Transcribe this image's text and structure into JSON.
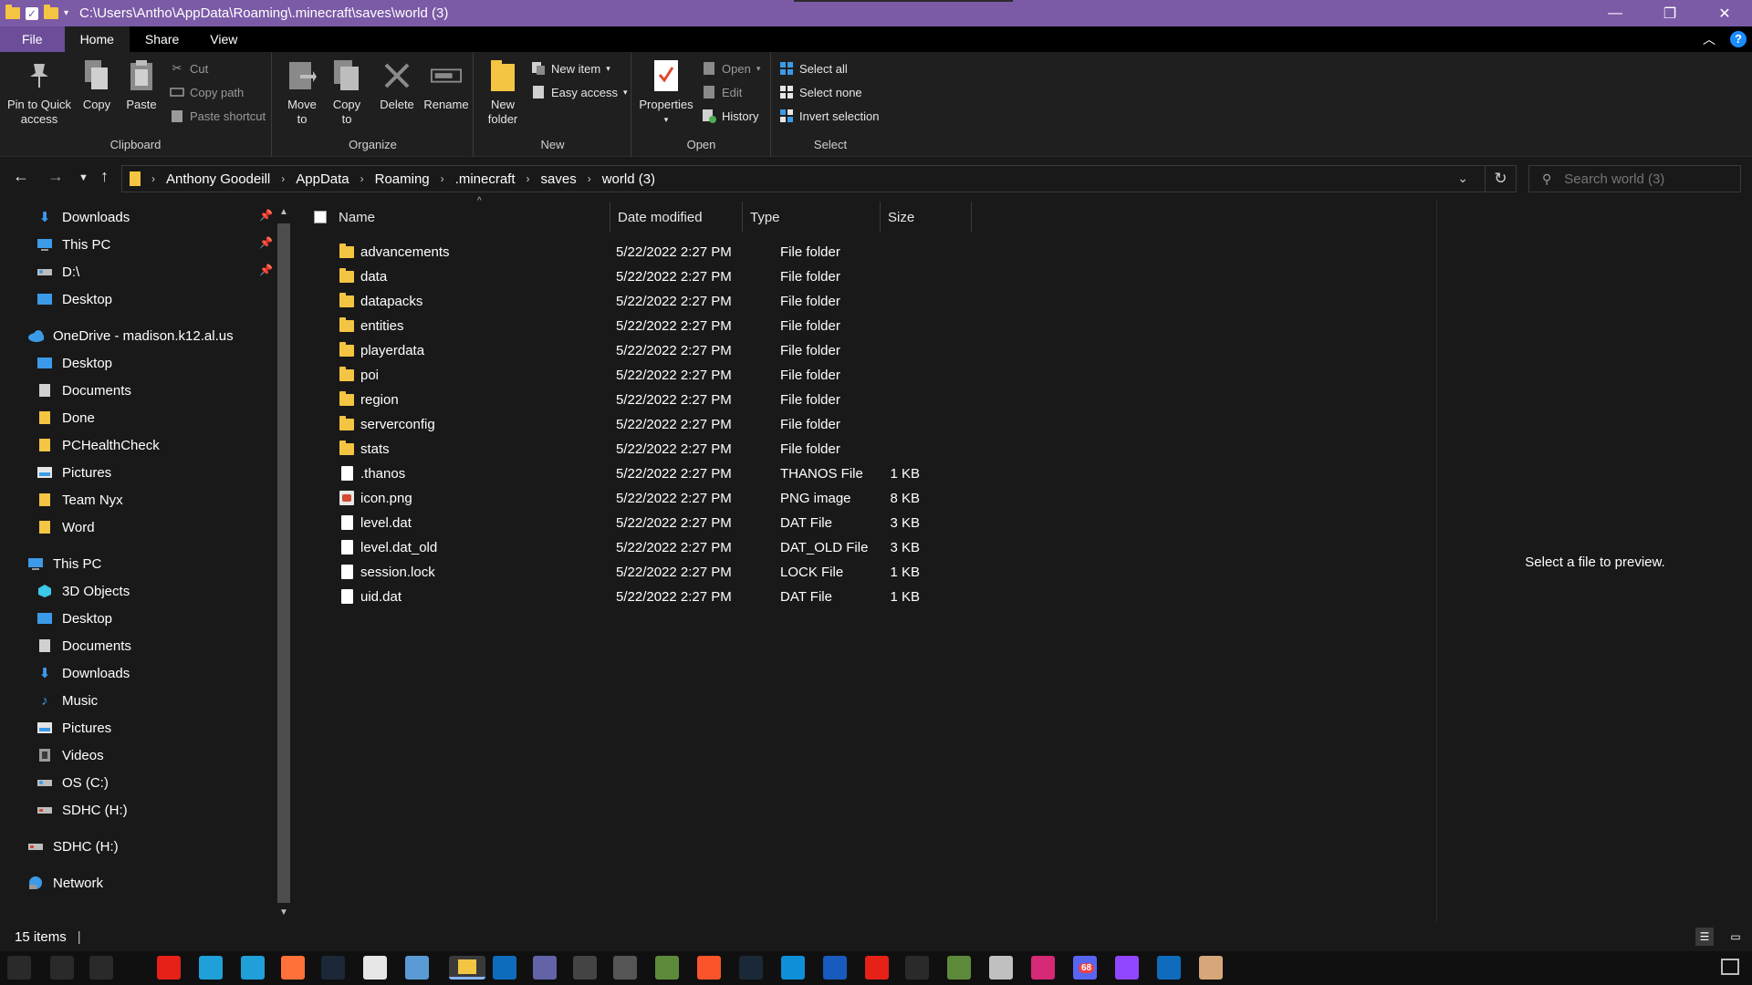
{
  "window": {
    "title_path": "C:\\Users\\Antho\\AppData\\Roaming\\.minecraft\\saves\\world (3)",
    "controls": {
      "minimize": "—",
      "restore": "❐",
      "close": "✕"
    }
  },
  "ribbon_tabs": [
    "File",
    "Home",
    "Share",
    "View"
  ],
  "ribbon": {
    "clipboard": {
      "label": "Clipboard",
      "pin": "Pin to Quick access",
      "pin_line1": "Pin to Quick",
      "pin_line2": "access",
      "copy": "Copy",
      "paste": "Paste",
      "cut": "Cut",
      "copy_path": "Copy path",
      "paste_shortcut": "Paste shortcut"
    },
    "organize": {
      "label": "Organize",
      "move_to_1": "Move",
      "move_to_2": "to",
      "copy_to_1": "Copy",
      "copy_to_2": "to",
      "delete": "Delete",
      "rename": "Rename"
    },
    "new": {
      "label": "New",
      "new_folder_1": "New",
      "new_folder_2": "folder",
      "new_item": "New item",
      "easy_access": "Easy access"
    },
    "open": {
      "label": "Open",
      "properties": "Properties",
      "open": "Open",
      "edit": "Edit",
      "history": "History"
    },
    "select": {
      "label": "Select",
      "select_all": "Select all",
      "select_none": "Select none",
      "invert_selection": "Invert selection"
    }
  },
  "address": {
    "crumbs": [
      "Anthony Goodeill",
      "AppData",
      "Roaming",
      ".minecraft",
      "saves",
      "world (3)"
    ],
    "search_placeholder": "Search world (3)"
  },
  "sidebar": {
    "quick_access": [
      "Downloads",
      "This PC",
      "D:\\",
      "Desktop"
    ],
    "onedrive_label": "OneDrive - madison.k12.al.us",
    "onedrive_items": [
      "Desktop",
      "Documents",
      "Done",
      "PCHealthCheck",
      "Pictures",
      "Team Nyx",
      "Word"
    ],
    "thispc_label": "This PC",
    "thispc_items": [
      "3D Objects",
      "Desktop",
      "Documents",
      "Downloads",
      "Music",
      "Pictures",
      "Videos",
      "OS (C:)",
      "SDHC (H:)"
    ],
    "sdhc_label": "SDHC (H:)",
    "network_label": "Network"
  },
  "columns": [
    "Name",
    "Date modified",
    "Type",
    "Size"
  ],
  "files": [
    {
      "name": "advancements",
      "date": "5/22/2022 2:27 PM",
      "type": "File folder",
      "size": "",
      "kind": "folder"
    },
    {
      "name": "data",
      "date": "5/22/2022 2:27 PM",
      "type": "File folder",
      "size": "",
      "kind": "folder"
    },
    {
      "name": "datapacks",
      "date": "5/22/2022 2:27 PM",
      "type": "File folder",
      "size": "",
      "kind": "folder"
    },
    {
      "name": "entities",
      "date": "5/22/2022 2:27 PM",
      "type": "File folder",
      "size": "",
      "kind": "folder"
    },
    {
      "name": "playerdata",
      "date": "5/22/2022 2:27 PM",
      "type": "File folder",
      "size": "",
      "kind": "folder"
    },
    {
      "name": "poi",
      "date": "5/22/2022 2:27 PM",
      "type": "File folder",
      "size": "",
      "kind": "folder"
    },
    {
      "name": "region",
      "date": "5/22/2022 2:27 PM",
      "type": "File folder",
      "size": "",
      "kind": "folder"
    },
    {
      "name": "serverconfig",
      "date": "5/22/2022 2:27 PM",
      "type": "File folder",
      "size": "",
      "kind": "folder"
    },
    {
      "name": "stats",
      "date": "5/22/2022 2:27 PM",
      "type": "File folder",
      "size": "",
      "kind": "folder"
    },
    {
      "name": ".thanos",
      "date": "5/22/2022 2:27 PM",
      "type": "THANOS File",
      "size": "1 KB",
      "kind": "file"
    },
    {
      "name": "icon.png",
      "date": "5/22/2022 2:27 PM",
      "type": "PNG image",
      "size": "8 KB",
      "kind": "image"
    },
    {
      "name": "level.dat",
      "date": "5/22/2022 2:27 PM",
      "type": "DAT File",
      "size": "3 KB",
      "kind": "file"
    },
    {
      "name": "level.dat_old",
      "date": "5/22/2022 2:27 PM",
      "type": "DAT_OLD File",
      "size": "3 KB",
      "kind": "file"
    },
    {
      "name": "session.lock",
      "date": "5/22/2022 2:27 PM",
      "type": "LOCK File",
      "size": "1 KB",
      "kind": "file"
    },
    {
      "name": "uid.dat",
      "date": "5/22/2022 2:27 PM",
      "type": "DAT File",
      "size": "1 KB",
      "kind": "file"
    }
  ],
  "preview_message": "Select a file to preview.",
  "status": {
    "item_count": "15 items"
  },
  "taskbar": {
    "apps": [
      "start-icon",
      "search-icon",
      "task-view-icon",
      "youtube-icon",
      "edge-icon",
      "edge-beta-icon",
      "firefox-icon",
      "steam-icon",
      "notepad-icon",
      "drawing-icon",
      "file-explorer-icon",
      "outlook-icon",
      "teams-icon",
      "roblox-icon",
      "app-icon",
      "minecraft-icon",
      "brave-icon",
      "steam2-icon",
      "whiteboard-icon",
      "word-icon",
      "b-icon",
      "cube-icon",
      "minecraft-launcher-icon",
      "photos-icon",
      "instagram-icon",
      "discord-icon",
      "twitch-icon",
      "snip-icon",
      "game-icon"
    ],
    "discord_badge": "68"
  },
  "colors": {
    "titlebar": "#7b5aa6",
    "file_tab": "#6b4d9a",
    "background": "#191919",
    "ribbon": "#1f1f1f",
    "folder": "#f4c542"
  }
}
